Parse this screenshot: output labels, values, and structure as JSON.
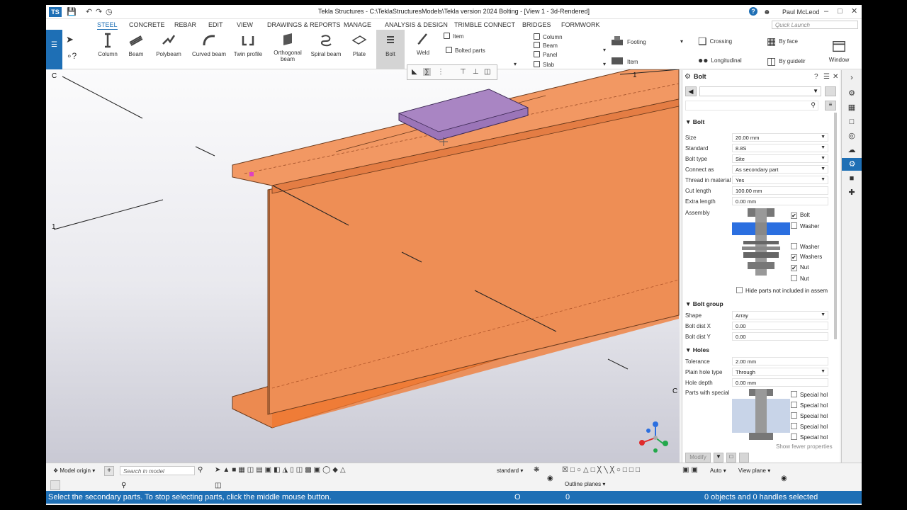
{
  "titlebar": {
    "title": "Tekla Structures - C:\\TeklaStructuresModels\\Tekla version 2024 Bolting  - [View 1 - 3d-Rendered]",
    "user": "Paul McLeod",
    "logo": "TS",
    "undo_icon": "undo-icon",
    "redo_icon": "redo-icon"
  },
  "menu": [
    "STEEL",
    "CONCRETE",
    "REBAR",
    "EDIT",
    "VIEW",
    "DRAWINGS & REPORTS",
    "MANAGE",
    "ANALYSIS & DESIGN",
    "TRIMBLE CONNECT",
    "BRIDGES",
    "FORMWORK"
  ],
  "quick_launch_placeholder": "Quick Launch",
  "ribbon": {
    "tools": [
      "Column",
      "Beam",
      "Polybeam",
      "Curved beam",
      "Twin profile",
      "Orthogonal beam",
      "Spiral beam",
      "Plate",
      "Bolt",
      "Weld"
    ],
    "mid_items": [
      "Item",
      "Bolted parts"
    ],
    "concrete_items": [
      "Column",
      "Beam",
      "Panel",
      "Slab"
    ],
    "footing": "Footing",
    "item": "Item",
    "crossing": "Crossing",
    "longitudinal": "Longitudinal",
    "by_face": "By face",
    "by_guideline": "By guidelir",
    "window": "Window"
  },
  "viewport": {
    "labels": {
      "c_top": "C",
      "one_left": "1",
      "one_top": "1",
      "c_right": "C"
    },
    "beam_color": "#ee8e55",
    "plate_color": "#9b75b8",
    "axis_colors": {
      "x": "#e02b2b",
      "y": "#23a84b",
      "z": "#2b6fe0"
    }
  },
  "panel": {
    "title": "Bolt",
    "bolt_section": "Bolt",
    "fields": [
      {
        "label": "Size",
        "value": "20.00 mm",
        "dropdown": true
      },
      {
        "label": "Standard",
        "value": "8.8S",
        "dropdown": true
      },
      {
        "label": "Bolt type",
        "value": "Site",
        "dropdown": true
      },
      {
        "label": "Connect as",
        "value": "As secondary part",
        "dropdown": true
      },
      {
        "label": "Thread in material",
        "value": "Yes",
        "dropdown": true
      },
      {
        "label": "Cut length",
        "value": "100.00 mm",
        "dropdown": false
      },
      {
        "label": "Extra length",
        "value": "0.00 mm",
        "dropdown": false
      }
    ],
    "assembly_label": "Assembly",
    "assembly_checks": [
      {
        "label": "Bolt",
        "checked": true
      },
      {
        "label": "Washer",
        "checked": false
      },
      {
        "label": "Washer",
        "checked": false
      },
      {
        "label": "Washers",
        "checked": true
      },
      {
        "label": "Nut",
        "checked": true
      },
      {
        "label": "Nut",
        "checked": false
      }
    ],
    "hide_parts": "Hide parts not included in assem",
    "group_section": "Bolt group",
    "group_fields": [
      {
        "label": "Shape",
        "value": "Array",
        "dropdown": true
      },
      {
        "label": "Bolt dist X",
        "value": "0.00",
        "dropdown": false
      },
      {
        "label": "Bolt dist Y",
        "value": "0.00",
        "dropdown": false
      }
    ],
    "holes_section": "Holes",
    "hole_fields": [
      {
        "label": "Tolerance",
        "value": "2.00 mm",
        "dropdown": false
      },
      {
        "label": "Plain hole type",
        "value": "Through",
        "dropdown": true
      },
      {
        "label": "Hole depth",
        "value": "0.00 mm",
        "dropdown": false
      }
    ],
    "special_label": "Parts with special",
    "special_checks": [
      "Special hol",
      "Special hol",
      "Special hol",
      "Special hol",
      "Special hol"
    ],
    "show_fewer": "Show fewer properties",
    "modify": "Modify"
  },
  "bottom": {
    "model_origin": "Model origin",
    "search_placeholder": "Search in model",
    "standard": "standard",
    "auto": "Auto",
    "view_plane": "View plane",
    "outline_planes": "Outline planes"
  },
  "status": {
    "message": "Select the secondary parts. To stop selecting parts, click the middle mouse button.",
    "o_label": "O",
    "zero": "0",
    "selection": "0 objects and 0 handles selected"
  }
}
